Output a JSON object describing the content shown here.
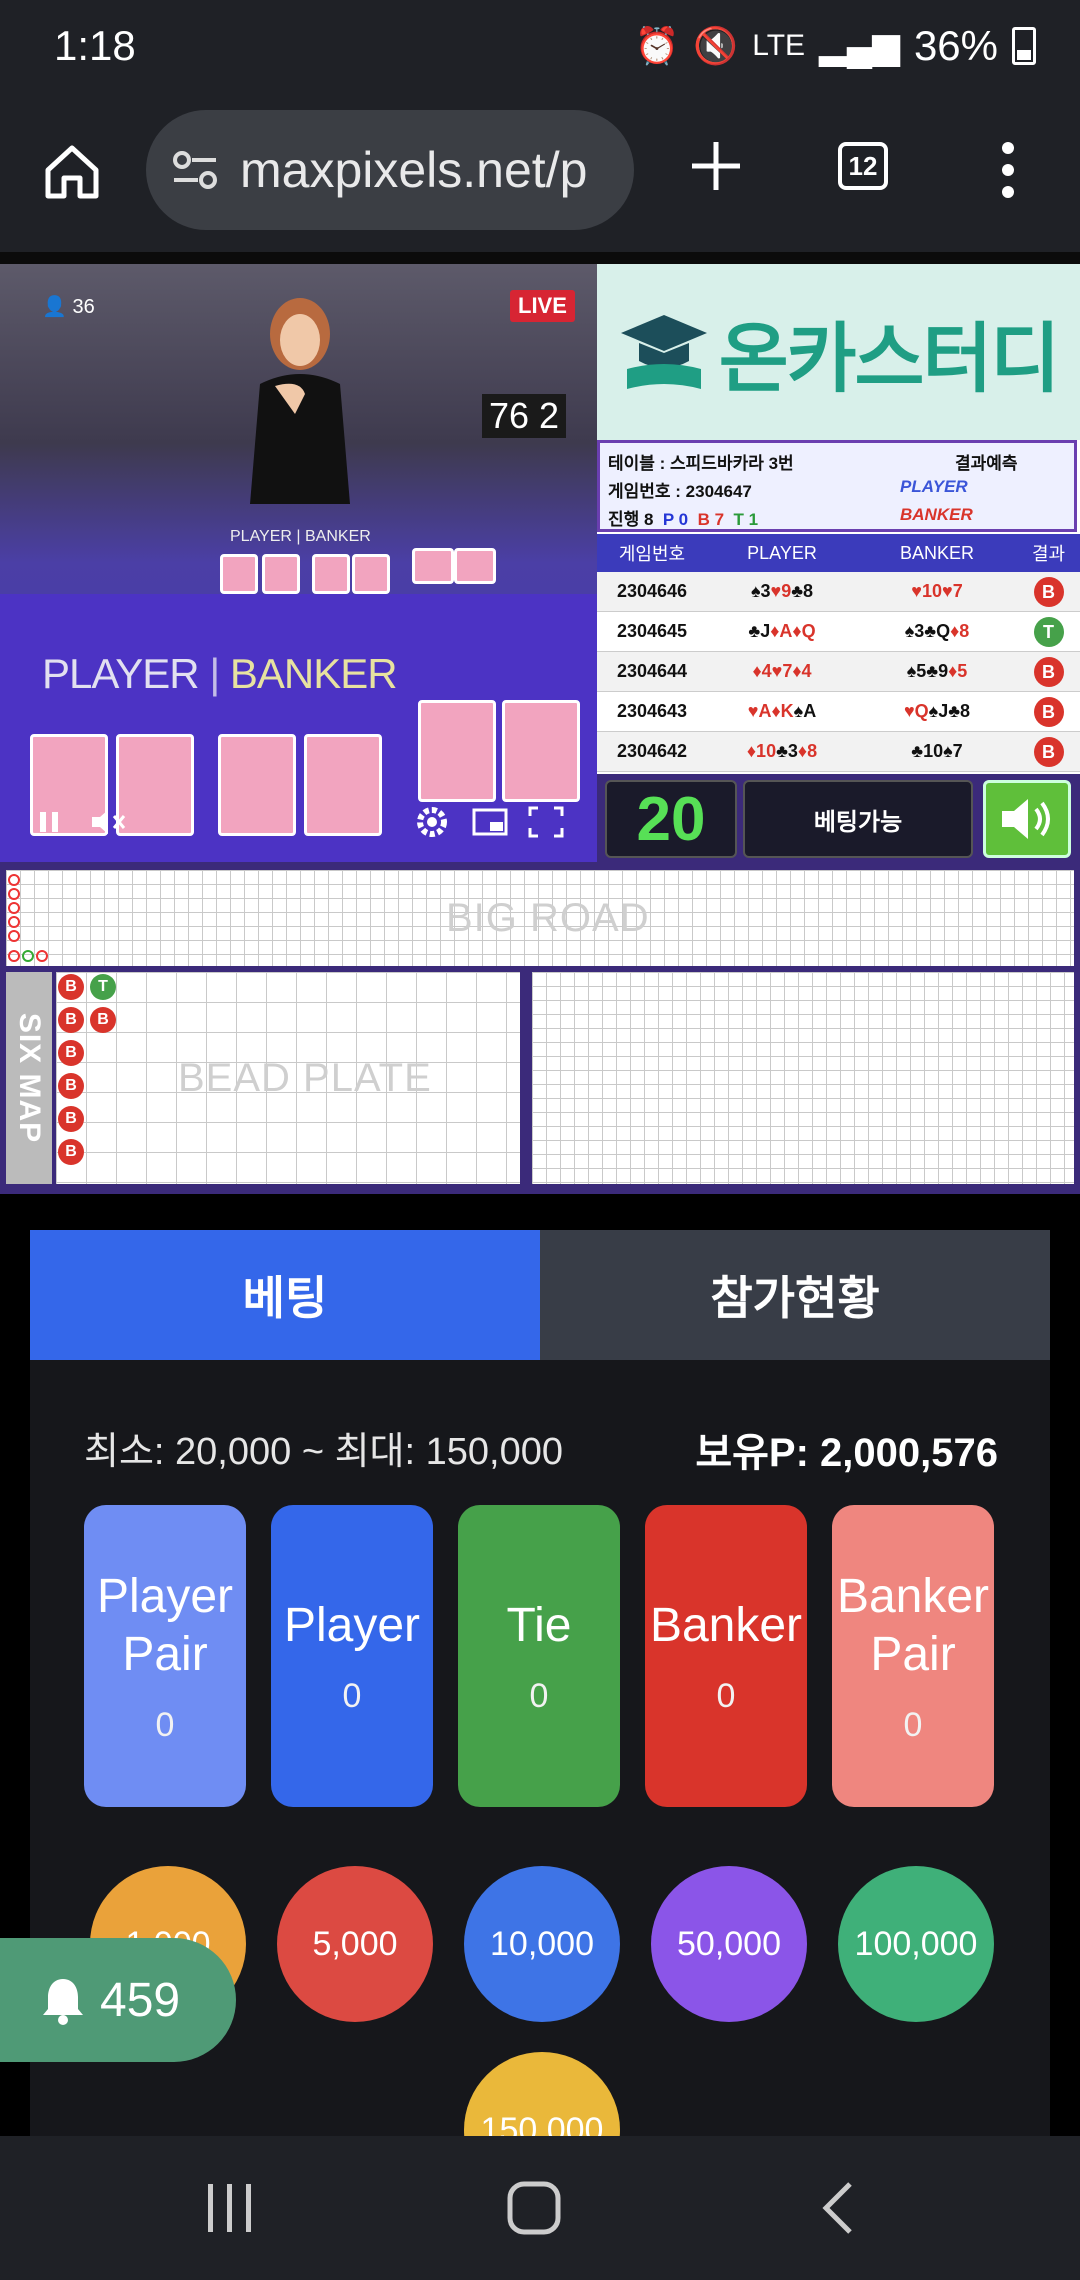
{
  "status_bar": {
    "time": "1:18",
    "network": "LTE",
    "battery": "36%"
  },
  "browser": {
    "url": "maxpixels.net/p",
    "tab_count": "12"
  },
  "video": {
    "viewers": "36",
    "live": "LIVE",
    "score": "76 2",
    "small_player_banker": "PLAYER | BANKER",
    "big_player": "PLAYER",
    "big_banker": "BANKER"
  },
  "logo": {
    "text": "온카스터디"
  },
  "info": {
    "table_label": "테이블 : 스피드바카라 3번",
    "prediction_label": "결과예측",
    "game_no_label": "게임번호 : 2304647",
    "prediction_player": "PLAYER",
    "progress_label": "진행 8",
    "p_count": "P 0",
    "b_count": "B 7",
    "t_count": "T 1",
    "prediction_banker": "BANKER"
  },
  "history": {
    "headers": [
      "게임번호",
      "PLAYER",
      "BANKER",
      "결과"
    ],
    "rows": [
      {
        "no": "2304646",
        "player": "♠3♥9♣8",
        "banker": "♥10♥7",
        "result": "B"
      },
      {
        "no": "2304645",
        "player": "♣J♦A♦Q",
        "banker": "♠3♣Q♦8",
        "result": "T"
      },
      {
        "no": "2304644",
        "player": "♦4♥7♦4",
        "banker": "♠5♣9♦5",
        "result": "B"
      },
      {
        "no": "2304643",
        "player": "♥A♦K♠A",
        "banker": "♥Q♠J♣8",
        "result": "B"
      },
      {
        "no": "2304642",
        "player": "♦10♣3♦8",
        "banker": "♣10♠7",
        "result": "B"
      }
    ]
  },
  "timer": "20",
  "betting_status": "베팅가능",
  "roads": {
    "big_road": "BIG ROAD",
    "bead_plate": "BEAD PLATE",
    "six_map": "SIX MAP",
    "bead_col1": [
      "B",
      "B",
      "B",
      "B",
      "B",
      "B"
    ],
    "bead_col2": [
      "T",
      "B"
    ]
  },
  "tabs": {
    "betting": "베팅",
    "participation": "참가현황"
  },
  "limits": "최소: 20,000 ~ 최대: 150,000",
  "balance": "보유P: 2,000,576",
  "bets": [
    {
      "line1": "Player",
      "line2": "Pair",
      "amount": "0"
    },
    {
      "line1": "Player",
      "line2": "",
      "amount": "0"
    },
    {
      "line1": "Tie",
      "line2": "",
      "amount": "0"
    },
    {
      "line1": "Banker",
      "line2": "",
      "amount": "0"
    },
    {
      "line1": "Banker",
      "line2": "Pair",
      "amount": "0"
    }
  ],
  "chips": [
    "1,000",
    "5,000",
    "10,000",
    "50,000",
    "100,000",
    "150,000"
  ],
  "notification_count": "459",
  "colors": {
    "banker": "#d9342b",
    "player": "#3467ea",
    "tie": "#46a14a",
    "player_pair": "#6f8df3",
    "banker_pair": "#ef867f",
    "accent_tab": "#3467ea"
  }
}
